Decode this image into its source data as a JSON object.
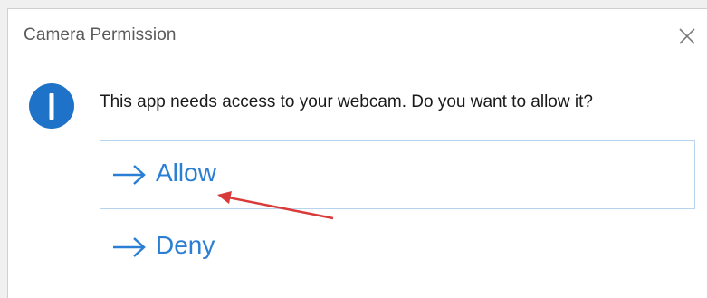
{
  "window": {
    "title": "Camera Permission",
    "close_icon": "close-icon"
  },
  "dialog": {
    "icon": "info-icon",
    "message": "This app needs access to your webcam. Do you want to allow it?"
  },
  "options": [
    {
      "label": "Allow",
      "icon": "arrow-right-icon"
    },
    {
      "label": "Deny",
      "icon": "arrow-right-icon"
    }
  ],
  "colors": {
    "accent": "#2a7fd4",
    "info_icon": "#1e73c8",
    "annotation": "#d93a3a"
  }
}
